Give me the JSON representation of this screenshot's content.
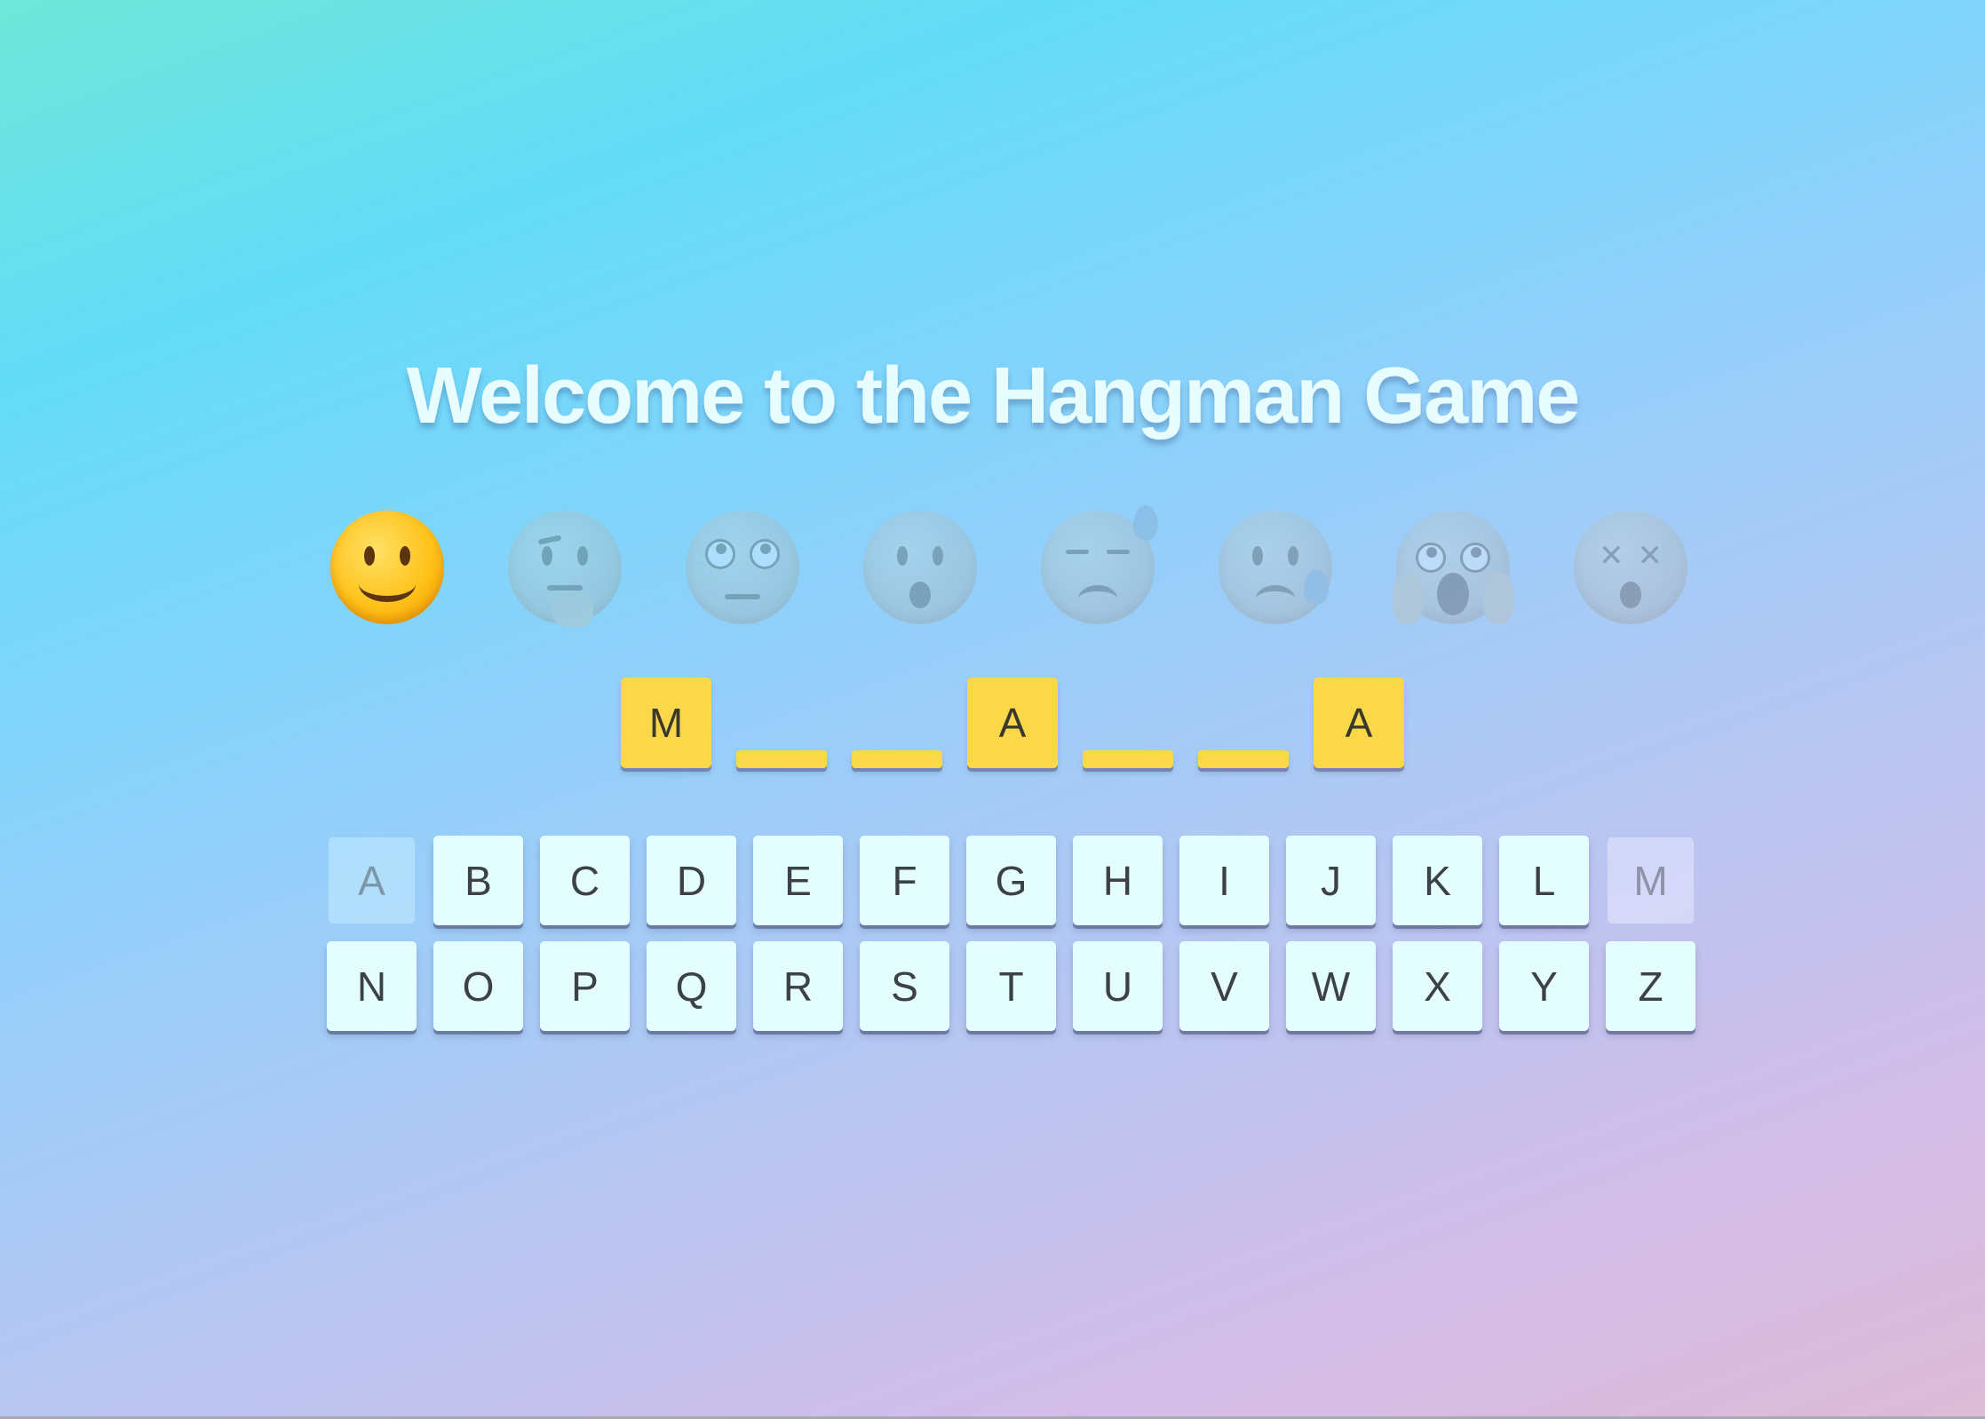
{
  "title": "Welcome to the Hangman Game",
  "emojis": [
    {
      "name": "slightly-smiling-face-icon",
      "active": true
    },
    {
      "name": "thinking-face-icon",
      "active": false
    },
    {
      "name": "face-with-rolling-eyes-icon",
      "active": false
    },
    {
      "name": "frowning-face-icon",
      "active": false
    },
    {
      "name": "downcast-face-with-sweat-icon",
      "active": false
    },
    {
      "name": "anxious-face-with-sweat-icon",
      "active": false
    },
    {
      "name": "face-screaming-in-fear-icon",
      "active": false
    },
    {
      "name": "dizzy-face-icon",
      "active": false
    }
  ],
  "word": {
    "slots": [
      "M",
      "",
      "",
      "A",
      "",
      "",
      "A"
    ]
  },
  "keyboard": {
    "row1": [
      "A",
      "B",
      "C",
      "D",
      "E",
      "F",
      "G",
      "H",
      "I",
      "J",
      "K",
      "L",
      "M"
    ],
    "row2": [
      "N",
      "O",
      "P",
      "Q",
      "R",
      "S",
      "T",
      "U",
      "V",
      "W",
      "X",
      "Y",
      "Z"
    ],
    "used": [
      "A",
      "M"
    ]
  },
  "colors": {
    "slot": "#fbd84a",
    "key": "#e4fdff",
    "title": "#e8fdff"
  }
}
